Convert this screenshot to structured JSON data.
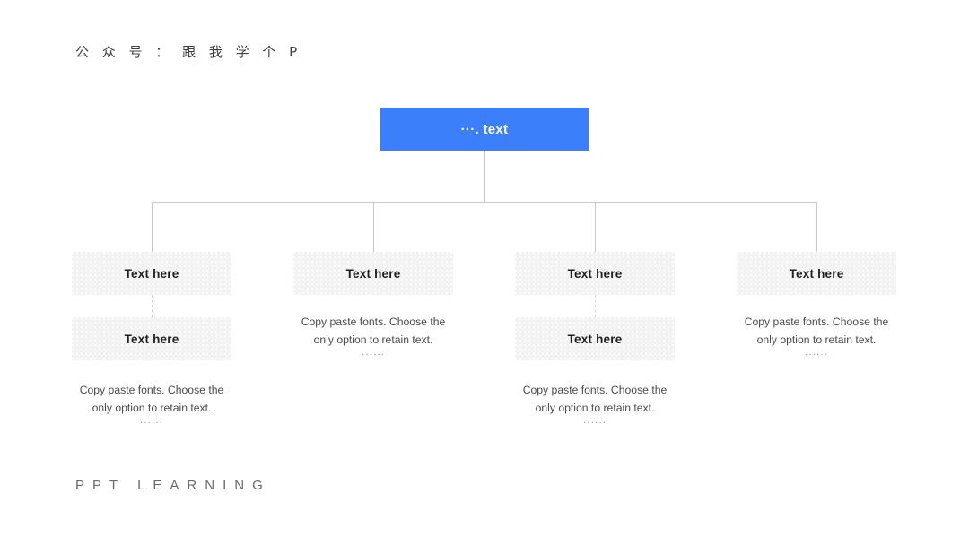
{
  "page": {
    "background_color": "#ffffff",
    "header_wordmark": "公 众 号 ： 跟 我 学 个 P",
    "footer_wordmark": "PPT  LEARNING"
  },
  "theme": {
    "accent_color": "#3b7ffa",
    "node_fill": "#f2f2f2",
    "connector_color": "#c9c9c9",
    "body_text_color": "#4a4a4a",
    "node_text_color": "#1f1f1f"
  },
  "diagram": {
    "type": "org-chart",
    "root": {
      "label": "···. text"
    },
    "branches": [
      {
        "id": "branch-1",
        "boxes": [
          {
            "label": "Text here"
          },
          {
            "label": "Text here"
          }
        ],
        "description": "Copy paste fonts. Choose the only option to retain text.",
        "description_line1": "Copy paste fonts. Choose the",
        "description_line2": "only option to retain text.",
        "dots": "······"
      },
      {
        "id": "branch-2",
        "boxes": [
          {
            "label": "Text here"
          }
        ],
        "description": "Copy paste fonts. Choose the only option to retain text.",
        "description_line1": "Copy paste fonts. Choose the",
        "description_line2": "only option to retain text.",
        "dots": "······"
      },
      {
        "id": "branch-3",
        "boxes": [
          {
            "label": "Text here"
          },
          {
            "label": "Text here"
          }
        ],
        "description": "Copy paste fonts. Choose the only option to retain text.",
        "description_line1": "Copy paste fonts. Choose the",
        "description_line2": "only option to retain text.",
        "dots": "······"
      },
      {
        "id": "branch-4",
        "boxes": [
          {
            "label": "Text here"
          }
        ],
        "description": "Copy paste fonts. Choose the only option to retain text.",
        "description_line1": "Copy paste fonts. Choose the",
        "description_line2": "only option to retain text.",
        "dots": "······"
      }
    ]
  }
}
